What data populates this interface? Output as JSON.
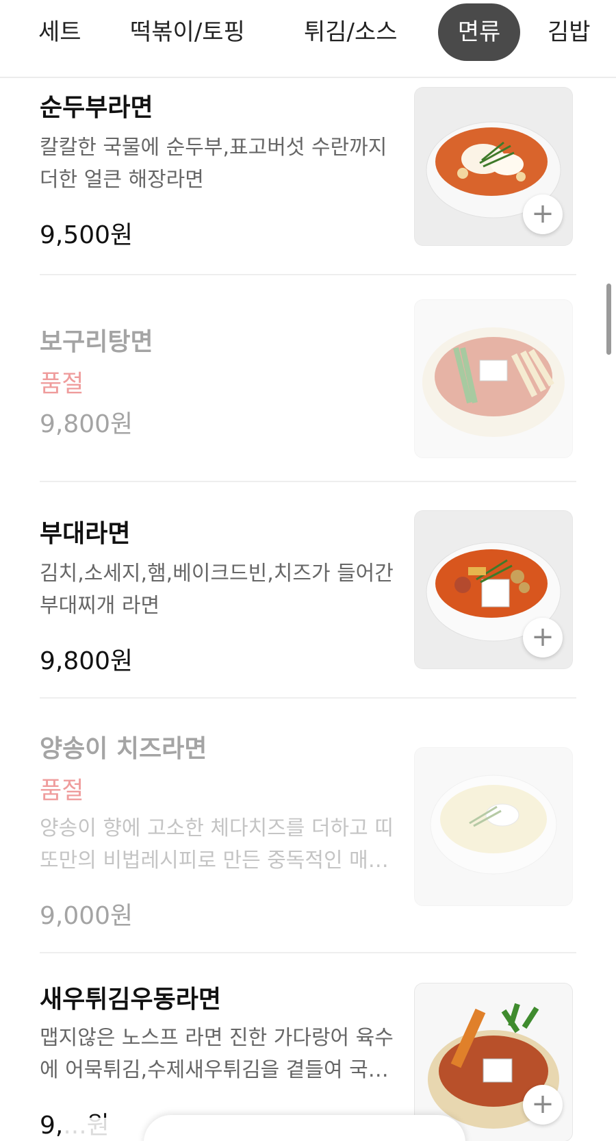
{
  "tabs": [
    {
      "label": "세트",
      "active": false
    },
    {
      "label": "떡볶이/토핑",
      "active": false
    },
    {
      "label": "튀김/소스",
      "active": false
    },
    {
      "label": "면류",
      "active": true
    },
    {
      "label": "김밥",
      "active": false
    }
  ],
  "menu": {
    "items": [
      {
        "name": "순두부라면",
        "description": "칼칼한 국물에 순두부,표고버섯 수란까지 더한 얼큰 해장라면",
        "price": "9,500원",
        "sold_out": false,
        "image_icon": "sundubu-ramen-bowl-image"
      },
      {
        "name": "보구리탕면",
        "sold_out_label": "품절",
        "price": "9,800원",
        "sold_out": true,
        "image_icon": "boguri-tangmyeon-pot-image"
      },
      {
        "name": "부대라면",
        "description": "김치,소세지,햄,베이크드빈,치즈가 들어간 부대찌개 라면",
        "price": "9,800원",
        "sold_out": false,
        "image_icon": "budae-ramen-bowl-image"
      },
      {
        "name": "양송이 치즈라면",
        "sold_out_label": "품절",
        "description": "양송이 향에 고소한 체다치즈를 더하고 띠또만의 비법레시피로 만든 중독적인 매…",
        "price": "9,000원",
        "sold_out": true,
        "image_icon": "mushroom-cheese-ramen-bowl-image"
      },
      {
        "name": "새우튀김우동라면",
        "description": "맵지않은 노스프 라면 진한 가다랑어 육수에 어묵튀김,수제새우튀김을 곁들여 국…",
        "price": "9,...원",
        "sold_out": false,
        "image_icon": "shrimp-tempura-udon-ramen-pot-image"
      }
    ],
    "add_button_symbol": "+"
  }
}
